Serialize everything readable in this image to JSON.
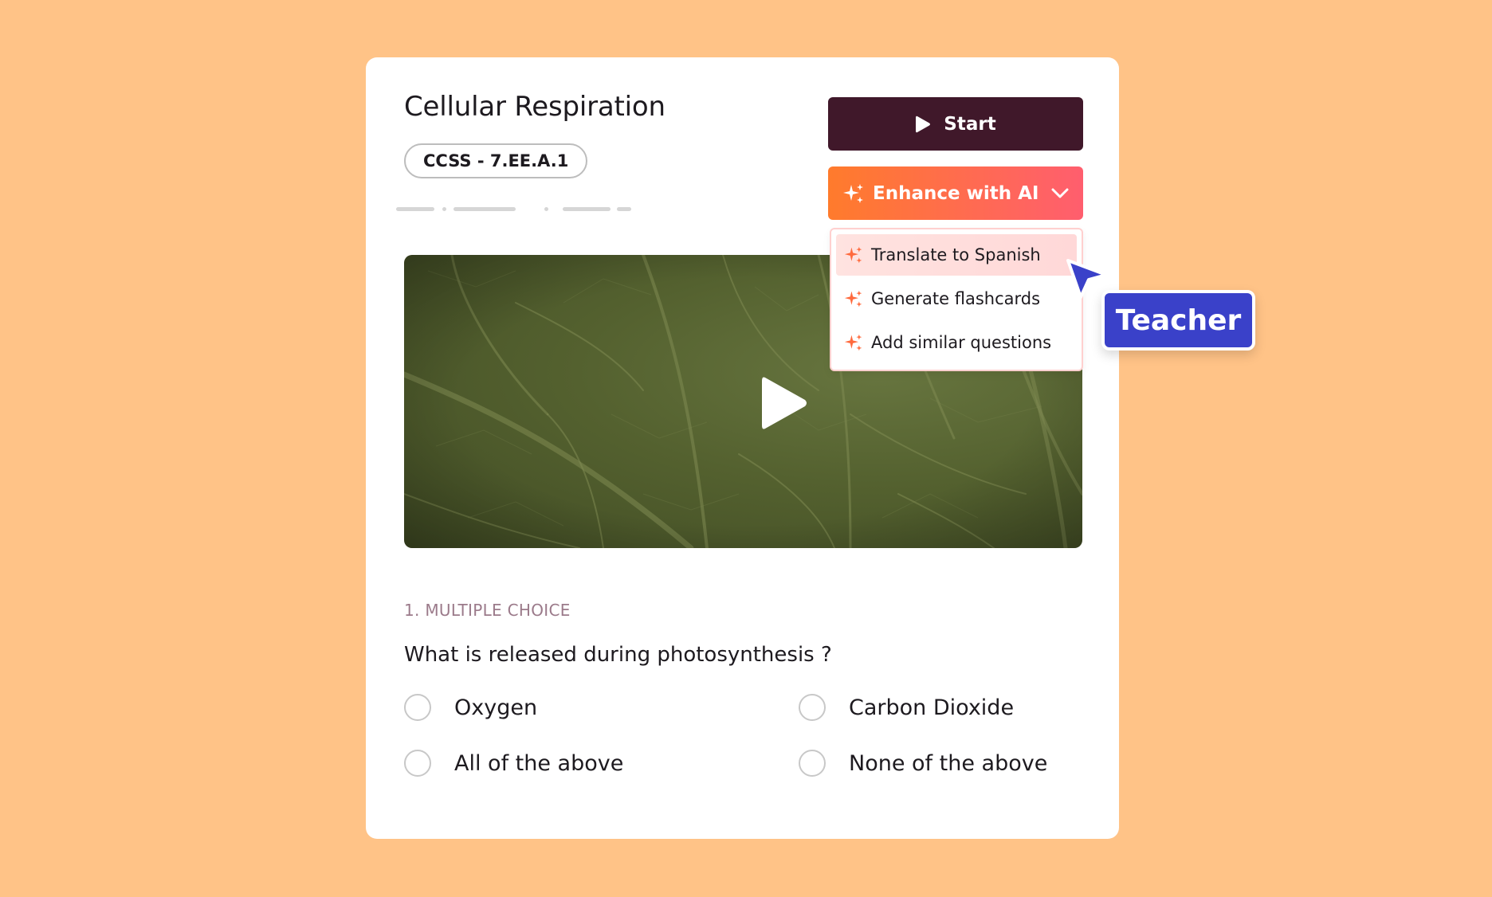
{
  "lesson": {
    "title": "Cellular Respiration",
    "standard_tag": "CCSS - 7.EE.A.1"
  },
  "actions": {
    "start_label": "Start",
    "enhance_label": "Enhance with AI",
    "enhance_menu": [
      "Translate to Spanish",
      "Generate flashcards",
      "Add similar questions"
    ]
  },
  "video": {
    "play_icon": "play-icon"
  },
  "question": {
    "type_label": "1. MULTIPLE CHOICE",
    "text": "What is released during photosynthesis ?",
    "options": [
      "Oxygen",
      "Carbon Dioxide",
      "All of the above",
      "None of the above"
    ]
  },
  "cursor_label": "Teacher",
  "colors": {
    "background": "#FFC387",
    "start_button": "#40182A",
    "ai_gradient_start": "#FF7B2C",
    "ai_gradient_end": "#FF5E6E",
    "teacher_badge": "#3A41C9"
  }
}
